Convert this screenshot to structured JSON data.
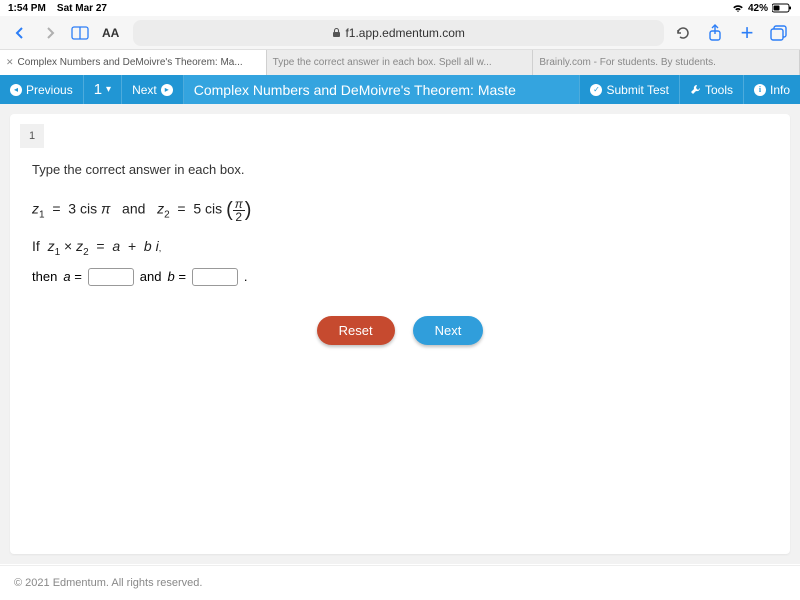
{
  "status": {
    "time": "1:54 PM",
    "date": "Sat Mar 27",
    "battery": "42%"
  },
  "browser": {
    "aa": "AA",
    "url_host": "f1.app.edmentum.com",
    "tabs": [
      "Complex Numbers and DeMoivre's Theorem: Ma...",
      "Type the correct answer in each box. Spell all w...",
      "Brainly.com - For students. By students."
    ]
  },
  "nav": {
    "prev": "Previous",
    "qnum": "1",
    "next": "Next",
    "title": "Complex Numbers and DeMoivre's Theorem: Maste",
    "submit": "Submit Test",
    "tools": "Tools",
    "info": "Info"
  },
  "question": {
    "number": "1",
    "instruction": "Type the correct answer in each box.",
    "then": "then",
    "a_label": "a =",
    "and": "and",
    "b_label": "b =",
    "period": "."
  },
  "buttons": {
    "reset": "Reset",
    "next": "Next"
  },
  "footer": "© 2021 Edmentum. All rights reserved."
}
